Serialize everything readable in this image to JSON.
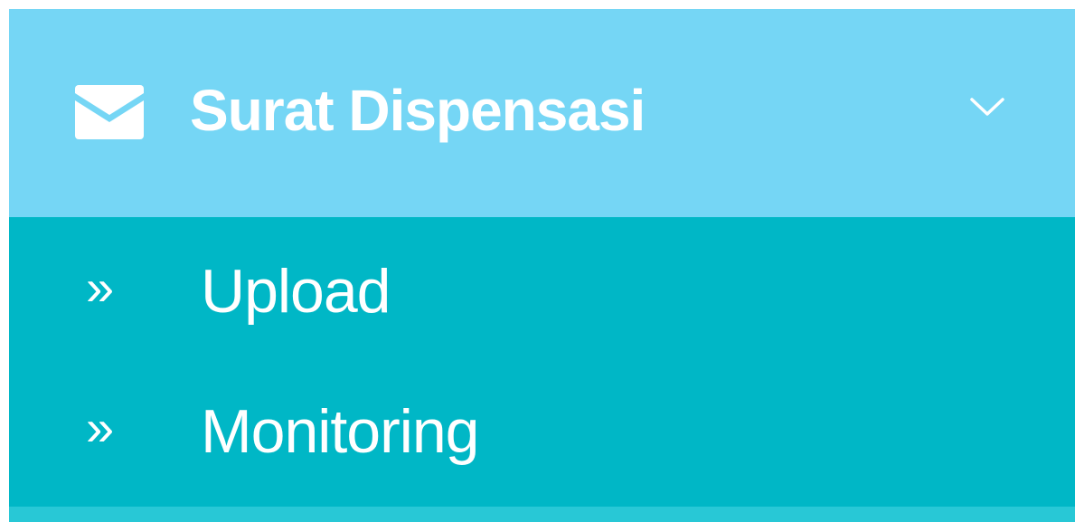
{
  "menu": {
    "header": {
      "icon": "envelope-icon",
      "label": "Surat Dispensasi",
      "expand_icon": "chevron-down-icon",
      "expanded": true
    },
    "items": [
      {
        "icon": "double-chevron-right-icon",
        "glyph": "»",
        "label": "Upload"
      },
      {
        "icon": "double-chevron-right-icon",
        "glyph": "»",
        "label": "Monitoring"
      }
    ]
  },
  "colors": {
    "header_bg": "#75d6f5",
    "submenu_bg": "#00b7c6",
    "bottom_strip": "#28c8d6",
    "text": "#ffffff"
  }
}
